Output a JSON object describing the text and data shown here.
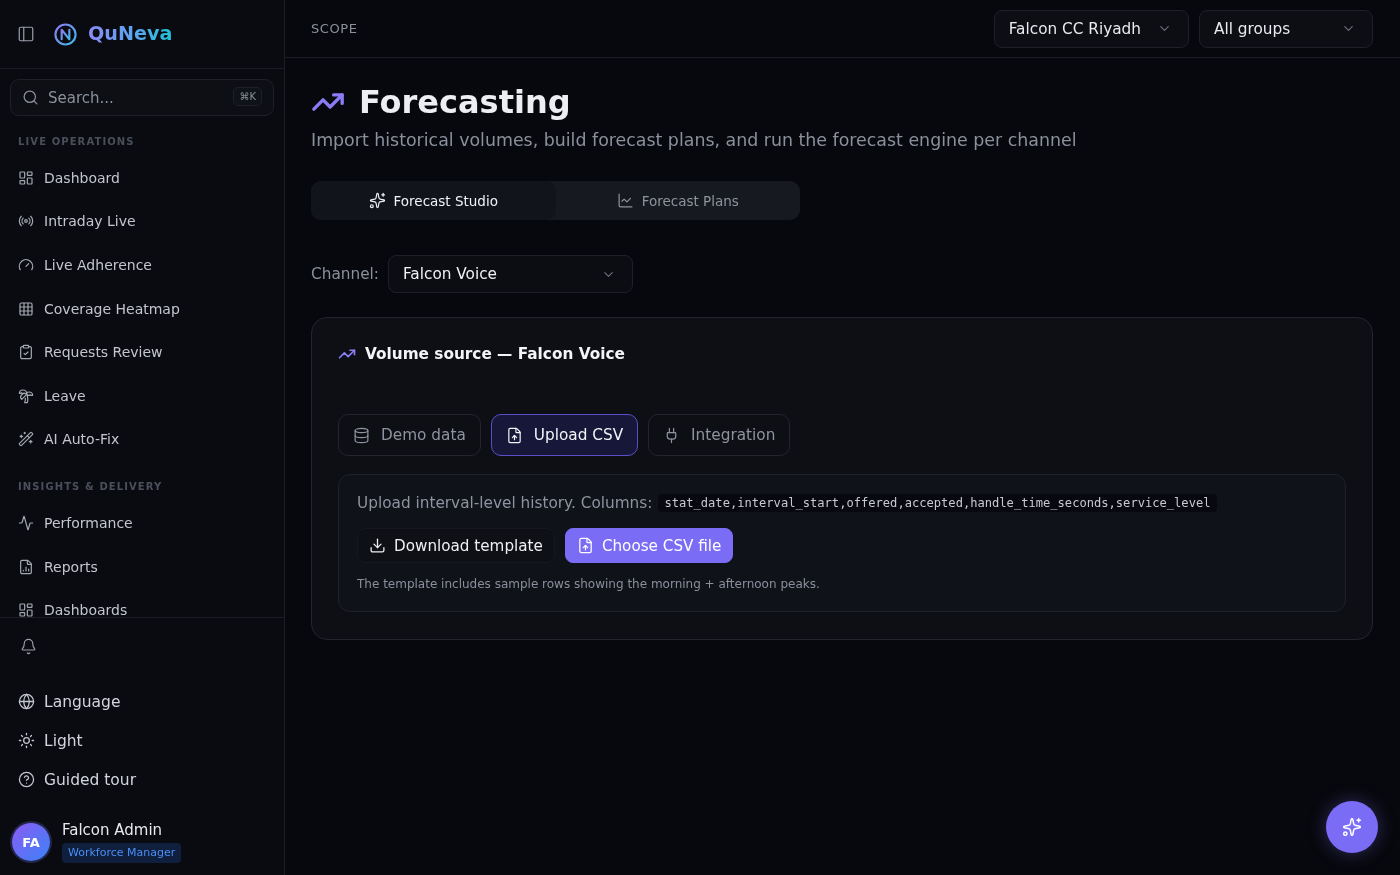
{
  "sidebar": {
    "brand": "QuNeva",
    "search": {
      "placeholder": "Search...",
      "shortcut": "⌘K"
    },
    "sections": [
      {
        "heading": "LIVE OPERATIONS",
        "items": [
          {
            "label": "Dashboard",
            "selected": false
          },
          {
            "label": "Intraday Live",
            "selected": false
          },
          {
            "label": "Live Adherence",
            "selected": false
          },
          {
            "label": "Coverage Heatmap",
            "selected": false
          },
          {
            "label": "Requests Review",
            "selected": false
          },
          {
            "label": "Leave",
            "selected": false
          },
          {
            "label": "AI Auto-Fix",
            "selected": false
          }
        ]
      },
      {
        "heading": "INSIGHTS & DELIVERY",
        "items": [
          {
            "label": "Performance",
            "selected": false
          },
          {
            "label": "Reports",
            "selected": false
          },
          {
            "label": "Dashboards",
            "selected": false
          }
        ]
      }
    ],
    "footer_items": [
      {
        "label": "Language"
      },
      {
        "label": "Light"
      },
      {
        "label": "Guided tour"
      }
    ],
    "user": {
      "initials": "FA",
      "name": "Falcon Admin",
      "role": "Workforce Manager"
    }
  },
  "top_bar": {
    "label": "SCOPE",
    "selects": [
      {
        "value": "Falcon CC Riyadh"
      },
      {
        "value": "All groups"
      }
    ]
  },
  "page": {
    "title": "Forecasting",
    "subtitle": "Import historical volumes, build forecast plans, and run the forecast engine per channel",
    "tabs": [
      {
        "label": "Forecast Studio",
        "selected": true
      },
      {
        "label": "Forecast Plans",
        "selected": false
      }
    ],
    "channel": {
      "label": "Channel:",
      "value": "Falcon Voice"
    },
    "volume_card": {
      "title": "Volume source — Falcon Voice",
      "sources": [
        {
          "label": "Demo data",
          "selected": false
        },
        {
          "label": "Upload CSV",
          "selected": true
        },
        {
          "label": "Integration",
          "selected": false
        }
      ],
      "upload": {
        "text": "Upload interval-level history. Columns:",
        "columns": "stat_date,interval_start,offered,accepted,handle_time_seconds,service_level",
        "buttons": [
          {
            "label": "Download template",
            "kind": "secondary"
          },
          {
            "label": "Choose CSV file",
            "kind": "primary"
          }
        ],
        "note": "The template includes sample rows showing the morning + afternoon peaks."
      }
    }
  }
}
